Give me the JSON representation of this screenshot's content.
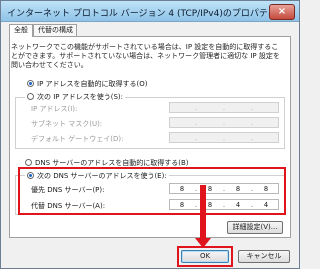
{
  "window": {
    "title": "インターネット プロトコル バージョン 4 (TCP/IPv4)のプロパティ",
    "close_label": "×"
  },
  "tabs": [
    {
      "label": "全般",
      "active": true
    },
    {
      "label": "代替の構成",
      "active": false
    }
  ],
  "description": "ネットワークでこの機能がサポートされている場合は、IP 設定を自動的に取得することができます。サポートされていない場合は、ネットワーク管理者に適切な IP 設定を問い合わせてください。",
  "ip_section": {
    "auto_label": "IP アドレスを自動的に取得する(O)",
    "auto_selected": true,
    "manual_label": "次の IP アドレスを使う(S):",
    "manual_selected": false,
    "fields": [
      {
        "label": "IP アドレス(I):",
        "octets": [
          "",
          "",
          "",
          ""
        ]
      },
      {
        "label": "サブネット マスク(U):",
        "octets": [
          "",
          "",
          "",
          ""
        ]
      },
      {
        "label": "デフォルト ゲートウェイ(D):",
        "octets": [
          "",
          "",
          "",
          ""
        ]
      }
    ]
  },
  "dns_section": {
    "auto_label": "DNS サーバーのアドレスを自動的に取得する(B)",
    "auto_selected": false,
    "manual_label": "次の DNS サーバーのアドレスを使う(E):",
    "manual_selected": true,
    "preferred": {
      "label": "優先 DNS サーバー(P):",
      "octets": [
        "8",
        "8",
        "8",
        "8"
      ]
    },
    "alternate": {
      "label": "代替 DNS サーバー(A):",
      "octets": [
        "8",
        "8",
        "4",
        "4"
      ]
    }
  },
  "buttons": {
    "advanced": "詳細設定(V)...",
    "ok": "OK",
    "cancel": "キャンセル"
  },
  "colors": {
    "highlight": "#e0141c",
    "radio_dot": "#1b63c4"
  }
}
